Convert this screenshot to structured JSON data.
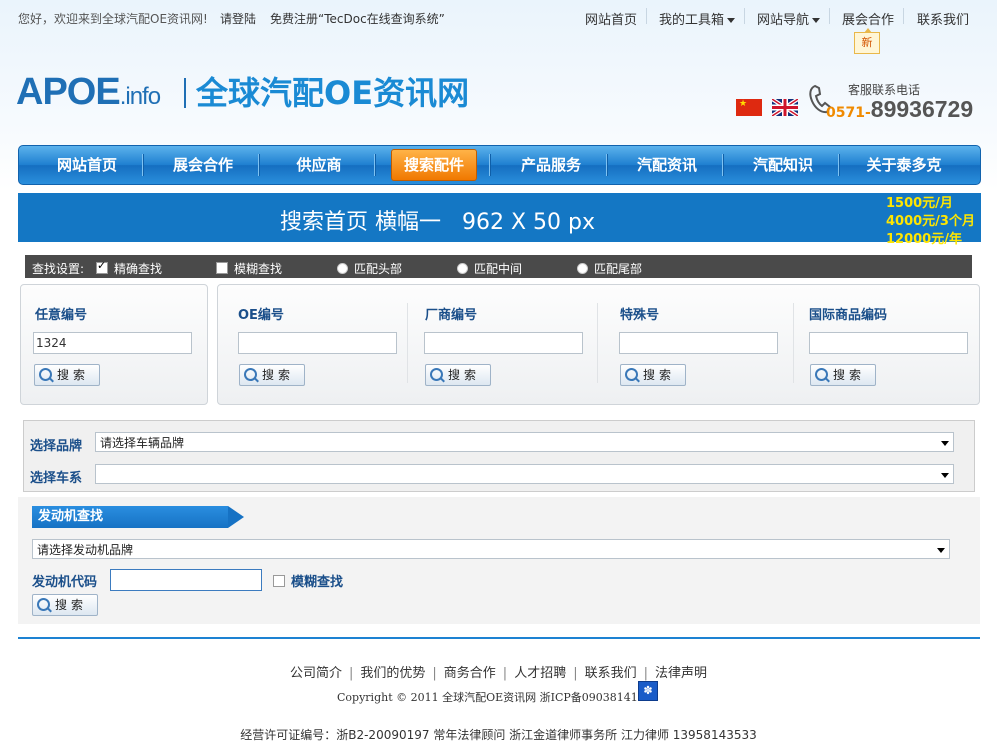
{
  "topbar": {
    "greeting": "您好，欢迎来到全球汽配OE资讯网!",
    "login": "请登陆",
    "register": "免费注册“TecDoc在线查询系统”",
    "links": [
      "网站首页",
      "我的工具箱",
      "网站导航",
      "展会合作",
      "联系我们"
    ],
    "new_badge": "新"
  },
  "header": {
    "logo_main": "APOE",
    "logo_suffix": ".info",
    "site_title": "全球汽配OE资讯网",
    "hotline_label": "客服联系电话",
    "hotline_prefix": "0571-",
    "hotline_number": "89936729"
  },
  "mainnav": {
    "items": [
      "网站首页",
      "展会合作",
      "供应商",
      "搜索配件",
      "产品服务",
      "汽配资讯",
      "汽配知识",
      "关于泰多克"
    ],
    "active": "搜索配件"
  },
  "banner": {
    "text": "搜索首页 横幅一   962 X 50 px",
    "prices": [
      "1500元/月",
      "4000元/3个月",
      "12000元/年"
    ]
  },
  "search_options": {
    "label": "查找设置:",
    "options": [
      "精确查找",
      "模糊查找",
      "匹配头部",
      "匹配中间",
      "匹配尾部"
    ]
  },
  "search_fields": [
    {
      "label": "任意编号",
      "value": "1324",
      "button": "搜索"
    },
    {
      "label": "OE编号",
      "value": "",
      "button": "搜索"
    },
    {
      "label": "厂商编号",
      "value": "",
      "button": "搜索"
    },
    {
      "label": "特殊号",
      "value": "",
      "button": "搜索"
    },
    {
      "label": "国际商品编码",
      "value": "",
      "button": "搜索"
    }
  ],
  "brand_select": {
    "brand_label": "选择品牌",
    "brand_value": "请选择车辆品牌",
    "series_label": "选择车系",
    "series_value": ""
  },
  "engine": {
    "tab": "发动机查找",
    "brand_value": "请选择发动机品牌",
    "code_label": "发动机代码",
    "code_value": "",
    "fuzzy_label": "模糊查找",
    "button": "搜索"
  },
  "footer": {
    "links": [
      "公司简介",
      "我们的优势",
      "商务合作",
      "人才招聘",
      "联系我们",
      "法律声明"
    ],
    "copyright": "Copyright © 2011 全球汽配OE资讯网 浙ICP备09038141",
    "license": "经营许可证编号：浙B2-20090197 常年法律顾问 浙江金道律师事务所 江力律师 13958143533"
  }
}
